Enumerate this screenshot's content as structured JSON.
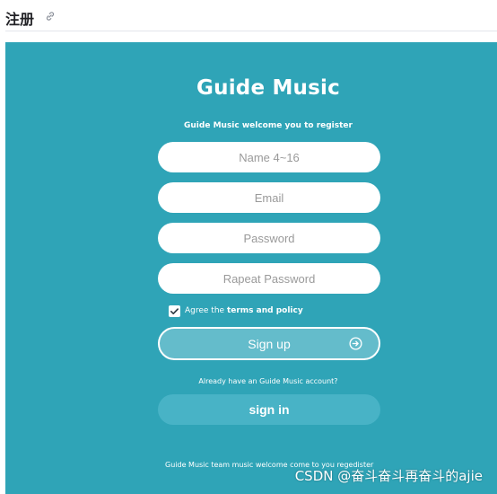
{
  "doc": {
    "title": "注册"
  },
  "panel": {
    "brand": "Guide Music",
    "subtitle": "Guide Music welcome you to register",
    "fields": [
      {
        "placeholder": "Name 4~16"
      },
      {
        "placeholder": "Email"
      },
      {
        "placeholder": "Password"
      },
      {
        "placeholder": "Rapeat Password"
      }
    ],
    "agree": {
      "prefix": "Agree the ",
      "link": "terms and policy",
      "checked": true
    },
    "signup_label": "Sign up",
    "already_text": "Already have an Guide Music account?",
    "signin_label": "sign in",
    "footer": "Guide Music team music welcome come to you regedister"
  },
  "watermark": "CSDN @奋斗奋斗再奋斗的ajie",
  "colors": {
    "panel_bg": "#2fa4b7",
    "signup_bg": "#64bccb",
    "signin_bg": "#48b3c6"
  },
  "icons": {
    "link": "link-icon",
    "check": "check-icon",
    "arrow": "arrow-right-circle-icon"
  }
}
